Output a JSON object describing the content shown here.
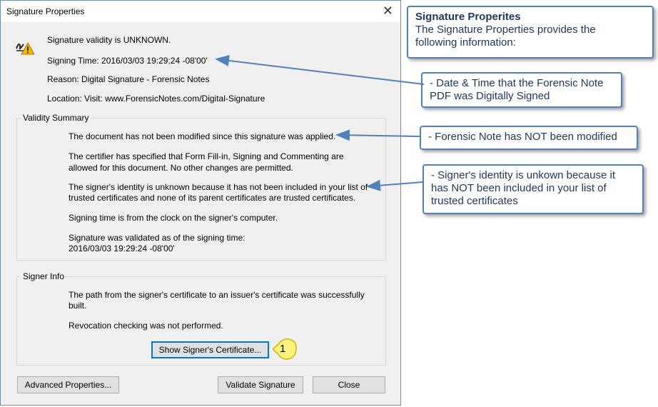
{
  "dialog": {
    "title": "Signature Properties",
    "validity": "Signature validity is UNKNOWN.",
    "signing_time": "Signing Time:  2016/03/03 19:29:24 -08'00'",
    "reason": "Reason:  Digital Signature - Forensic Notes",
    "location": "Location:  Visit: www.ForensicNotes.com/Digital-Signature",
    "validity_summary": {
      "label": "Validity Summary",
      "line1": "The document has not been modified since this signature was applied.",
      "line2a": "The certifier has specified that Form Fill-in, Signing and Commenting are",
      "line2b": "allowed for this document. No other changes are permitted.",
      "line3a": "The signer's identity is unknown because it has not been included in your list of",
      "line3b": "trusted certificates and none of its parent certificates are trusted certificates.",
      "line4": "Signing time is from the clock on the signer's computer.",
      "line5a": "Signature was validated as of the signing time:",
      "line5b": "2016/03/03 19:29:24 -08'00'"
    },
    "signer_info": {
      "label": "Signer Info",
      "line1a": "The path from the signer's certificate to an issuer's certificate was successfully",
      "line1b": "built.",
      "line2": "Revocation checking was not performed.",
      "show_cert_button": "Show Signer's Certificate..."
    },
    "buttons": {
      "advanced": "Advanced Properties...",
      "validate": "Validate Signature",
      "close": "Close"
    }
  },
  "callouts": {
    "main_title": "Signature Properites",
    "main_text_1": "The Signature Properties provides the",
    "main_text_2": "following information:",
    "date_1": "- Date & Time that the Forensic Note",
    "date_2": "PDF was Digitally Signed",
    "modified": "- Forensic Note has NOT been modified",
    "identity_1": "- Signer's identity is unkown because it",
    "identity_2": "has NOT been included in your list of",
    "identity_3": "trusted certificates"
  },
  "badge_number": "1",
  "colors": {
    "callout_border": "#4f81bd",
    "callout_text": "#1f3864",
    "arrow": "#4f81bd",
    "badge_fill": "#fff27a",
    "badge_stroke": "#d8b200",
    "warning": "#f5b400"
  }
}
